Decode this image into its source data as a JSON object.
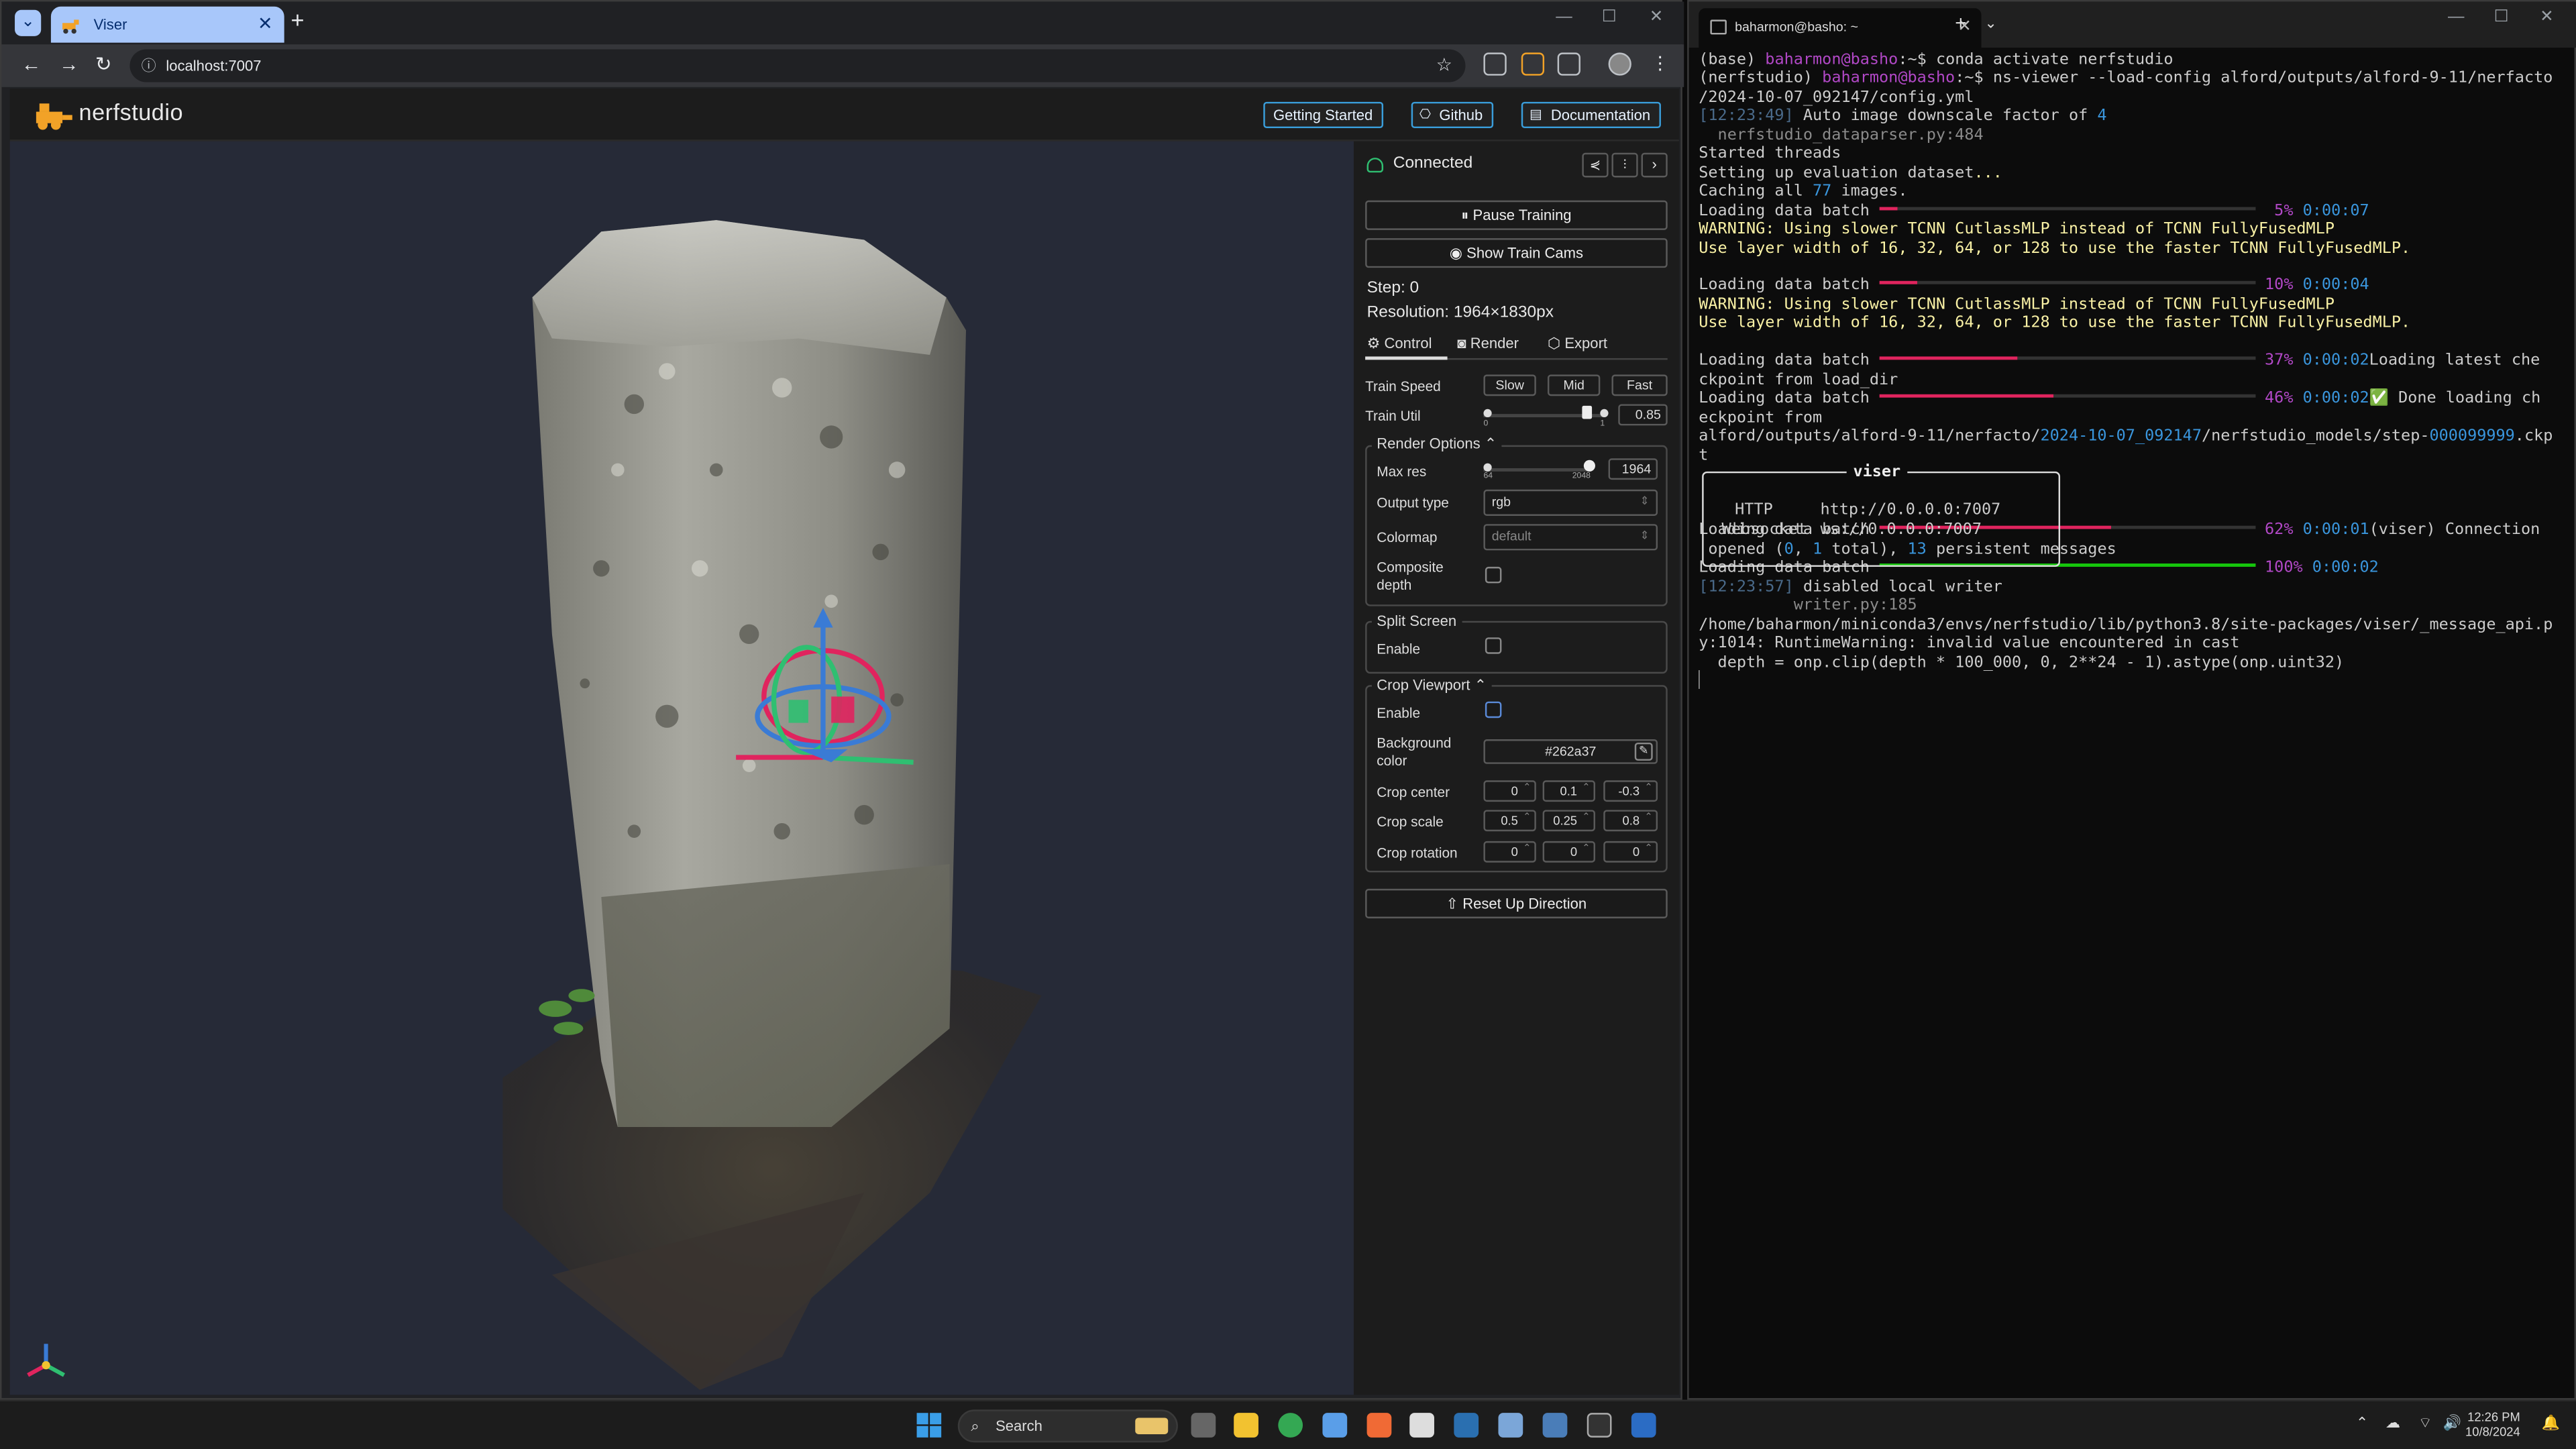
{
  "browser": {
    "tab_title": "Viser",
    "url": "localhost:7007"
  },
  "nerfstudio": {
    "logo_text": "nerfstudio",
    "header_buttons": [
      "Getting Started",
      "Github",
      "Documentation"
    ],
    "status": "Connected",
    "pause_training": "Pause Training",
    "show_train_cams": "Show Train Cams",
    "step": "Step: 0",
    "resolution": "Resolution: 1964×1830px",
    "tabs": [
      "Control",
      "Render",
      "Export"
    ],
    "train_speed_label": "Train Speed",
    "train_speed_options": [
      "Slow",
      "Mid",
      "Fast"
    ],
    "train_util_label": "Train Util",
    "train_util_min": "0",
    "train_util_max": "1",
    "train_util_value": "0.85",
    "render_options": {
      "legend": "Render Options",
      "max_res_label": "Max res",
      "max_res_min": "64",
      "max_res_max": "2048",
      "max_res_value": "1964",
      "output_type_label": "Output type",
      "output_type_value": "rgb",
      "colormap_label": "Colormap",
      "colormap_value": "default",
      "composite_depth_label": "Composite depth"
    },
    "split_screen": {
      "legend": "Split Screen",
      "enable_label": "Enable"
    },
    "crop_viewport": {
      "legend": "Crop Viewport",
      "enable_label": "Enable",
      "bg_color_label": "Background color",
      "bg_color_value": "#262a37",
      "crop_center_label": "Crop center",
      "crop_center": [
        "0",
        "0.1",
        "-0.3"
      ],
      "crop_scale_label": "Crop scale",
      "crop_scale": [
        "0.5",
        "0.25",
        "0.8"
      ],
      "crop_rotation_label": "Crop rotation",
      "crop_rotation": [
        "0",
        "0",
        "0"
      ]
    },
    "reset_up": "Reset Up Direction"
  },
  "terminal": {
    "tab_title": "baharmon@basho: ~",
    "lines": {
      "l1": "(base) ",
      "l1u": "baharmon@basho",
      "l1b": ":~$ conda activate nerfstudio",
      "l2": "(nerfstudio) ",
      "l2u": "baharmon@basho",
      "l2b": ":~$ ns-viewer --load-config alford/outputs/alford-9-11/nerfacto",
      "l3": "/2024-10-07_092147/config.yml",
      "l4t": "[12:23:49]",
      "l4": " Auto image downscale factor of ",
      "l4n": "4",
      "l5": "  nerfstudio_dataparser.py:484",
      "l6": "Started threads",
      "l7": "Setting up evaluation dataset",
      "l7d": "...",
      "l8": "Caching all ",
      "l8n": "77",
      "l8b": " images.",
      "batch": "Loading data batch ",
      "p1": "5%",
      "t1": "0:00:07",
      "warn1": "WARNING: Using slower TCNN CutlassMLP instead of TCNN FullyFusedMLP",
      "warn2": "Use layer width of 16, 32, 64, or 128 to use the faster TCNN FullyFusedMLP.",
      "p2": "10%",
      "t2": "0:00:04",
      "p3": "37%",
      "t3": "0:00:02",
      "l_latest": "Loading latest che",
      "l_latest2": "ckpoint from load_dir",
      "p4": "46%",
      "t4": "0:00:02",
      "l_done": " Done loading ch",
      "l_done2": "eckpoint from",
      "l_path_a": "alford/outputs/alford-9-11/nerfacto/",
      "l_path_b": "2024-10-07_092147",
      "l_path_c": "/nerfstudio_models/step-",
      "l_path_d": "000099999",
      "l_path_e": ".ckp",
      "l_path_f": "t",
      "viser_title": "viser",
      "http_label": "HTTP",
      "http_url": "http://0.0.0.0:7007",
      "ws_label": "Websocket",
      "ws_url": "ws://0.0.0.0:7007",
      "p5": "62%",
      "t5": "0:00:01",
      "conn_a": "(viser)",
      "conn_b": " Connection",
      "conn2a": " opened (",
      "conn2n1": "0",
      "conn2b": ", ",
      "conn2n2": "1",
      "conn2c": " total), ",
      "conn2n3": "13",
      "conn2d": " persistent messages",
      "p6": "100%",
      "t6": "0:00:02",
      "l_w_t": "[12:23:57]",
      "l_w": " disabled local writer",
      "l_w2": "          writer.py:185",
      "rt1": "/home/baharmon/miniconda3/envs/nerfstudio/lib/python3.8/site-packages/viser/_message_api.p",
      "rt2": "y:1014: RuntimeWarning: invalid value encountered in cast",
      "rt3": "  depth = onp.clip(depth * 100_000, 0, 2**24 - 1).astype(onp.uint32)"
    }
  },
  "taskbar": {
    "search": "Search",
    "time": "12:26 PM",
    "date": "10/8/2024"
  }
}
